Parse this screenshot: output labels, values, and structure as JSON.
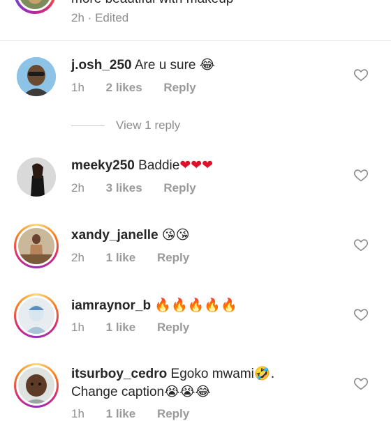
{
  "top_comment": {
    "text_fragment": "more beautiful with makeup",
    "time": "2h",
    "edited": "Edited",
    "separator": "·"
  },
  "view_replies": "View 1 reply",
  "comments": [
    {
      "username": "j.osh_250",
      "text": "Are u sure",
      "emoji": "😂",
      "time": "1h",
      "likes": "2 likes",
      "reply": "Reply"
    },
    {
      "username": "meeky250",
      "text": "Baddie",
      "emoji": "❤❤❤",
      "time": "2h",
      "likes": "3 likes",
      "reply": "Reply"
    },
    {
      "username": "xandy_janelle",
      "text": "",
      "emoji": "😘😘",
      "time": "2h",
      "likes": "1 like",
      "reply": "Reply"
    },
    {
      "username": "iamraynor_b",
      "text": "",
      "emoji": "🔥🔥🔥🔥🔥",
      "time": "1h",
      "likes": "1 like",
      "reply": "Reply"
    },
    {
      "username": "itsurboy_cedro",
      "text": "Egoko mwami",
      "emoji": "🤣.",
      "line2": "Change caption",
      "emoji2": "😭😭😂",
      "time": "1h",
      "likes": "1 like",
      "reply": "Reply"
    }
  ],
  "colors": {
    "heart": "#8e8e8e",
    "meta": "#8e8e8e",
    "text": "#262626"
  },
  "icons": {
    "like": "heart-outline-icon"
  }
}
